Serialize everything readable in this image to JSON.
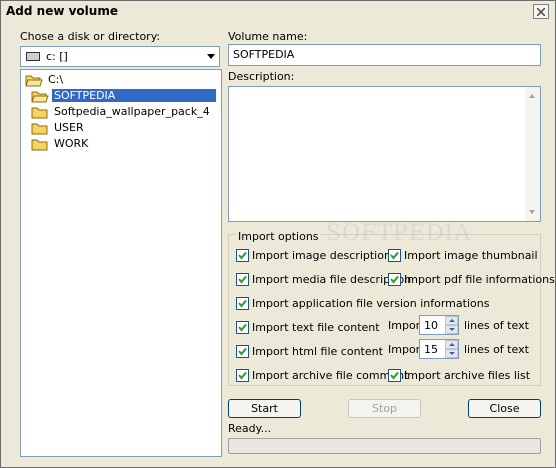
{
  "window": {
    "title": "Add new volume"
  },
  "left": {
    "disk_label": "Chose a disk or directory:",
    "drive_value": "c: []",
    "tree": [
      {
        "label": "C:\\",
        "selected": false
      },
      {
        "label": "SOFTPEDIA",
        "selected": true
      },
      {
        "label": "Softpedia_wallpaper_pack_4",
        "selected": false
      },
      {
        "label": "USER",
        "selected": false
      },
      {
        "label": "WORK",
        "selected": false
      }
    ]
  },
  "right": {
    "volume_name_label": "Volume name:",
    "volume_name_value": "SOFTPEDIA",
    "description_label": "Description:",
    "description_value": ""
  },
  "import_options": {
    "title": "Import options",
    "image_description": {
      "label": "Import image description",
      "checked": true
    },
    "image_thumbnail": {
      "label": "Import image thumbnail",
      "checked": true
    },
    "media_description": {
      "label": "Import media file description",
      "checked": true
    },
    "pdf_info": {
      "label": "Import pdf file informations",
      "checked": true
    },
    "app_version": {
      "label": "Import application file version informations",
      "checked": true
    },
    "text_content": {
      "label": "Import text file content",
      "checked": true
    },
    "html_content": {
      "label": "Import html file content",
      "checked": true
    },
    "archive_comment": {
      "label": "Import archive file comment",
      "checked": true
    },
    "archive_list": {
      "label": "Import archive files list",
      "checked": true
    },
    "text_import_prefix": "Import",
    "text_lines": "10",
    "text_suffix": "lines of text",
    "html_import_prefix": "Import",
    "html_lines": "15",
    "html_suffix": "lines of text"
  },
  "buttons": {
    "start": "Start",
    "stop": "Stop",
    "close": "Close"
  },
  "status": {
    "text": "Ready...",
    "progress": 0
  },
  "watermark": "SOFTPEDIA",
  "colors": {
    "selection": "#316ac5",
    "window_bg": "#ece9d8",
    "folder": "#f5d35c"
  }
}
